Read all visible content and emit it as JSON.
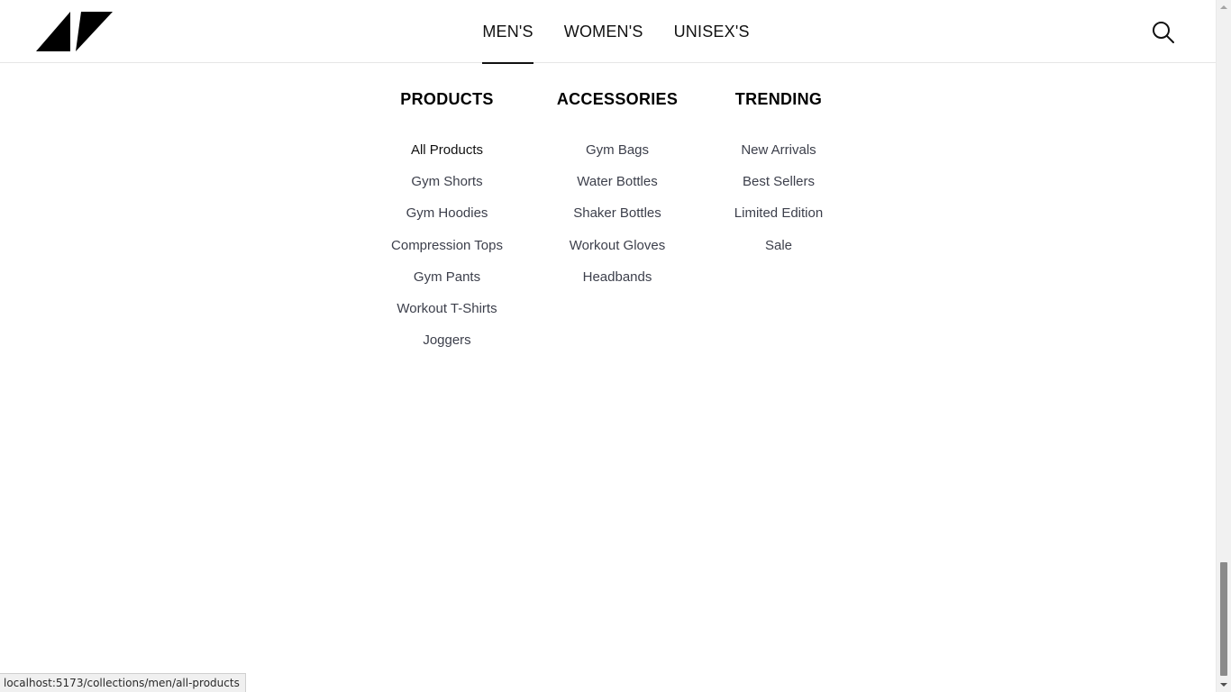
{
  "brand": {
    "logo_icon": "brand-logo-icon"
  },
  "nav": {
    "items": [
      {
        "label": "MEN'S",
        "active": true
      },
      {
        "label": "WOMEN'S",
        "active": false
      },
      {
        "label": "UNISEX'S",
        "active": false
      }
    ],
    "search_icon": "search-icon"
  },
  "mega_menu": {
    "columns": [
      {
        "title": "PRODUCTS",
        "links": [
          "All Products",
          "Gym Shorts",
          "Gym Hoodies",
          "Compression Tops",
          "Gym Pants",
          "Workout T-Shirts",
          "Joggers"
        ]
      },
      {
        "title": "ACCESSORIES",
        "links": [
          "Gym Bags",
          "Water Bottles",
          "Shaker Bottles",
          "Workout Gloves",
          "Headbands"
        ]
      },
      {
        "title": "TRENDING",
        "links": [
          "New Arrivals",
          "Best Sellers",
          "Limited Edition",
          "Sale"
        ]
      }
    ]
  },
  "status_bar": {
    "url": "localhost:5173/collections/men/all-products"
  },
  "colors": {
    "text_primary": "#111111",
    "link": "#3c3f4b",
    "border": "#e6e6e6"
  }
}
